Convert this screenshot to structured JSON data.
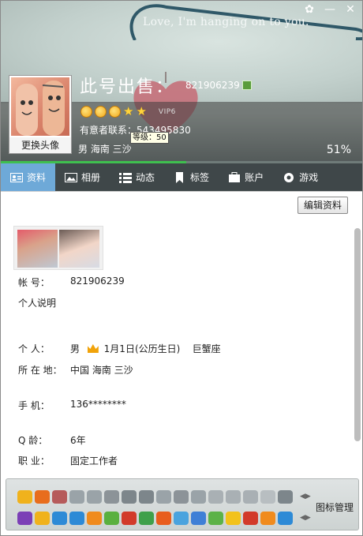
{
  "header": {
    "caption": "Love, I'm hanging on to you.",
    "nickname": "此号出售：",
    "qq_number": "821906239",
    "contact": "有意者联系：543495830",
    "basic": "男   海南 三沙",
    "vip": "VIP6",
    "level_tooltip": "等级：50",
    "profile_completion": "51%",
    "profile_completion_value": 51,
    "avatar_change": "更换头像",
    "window_controls": {
      "skin": "✿",
      "minimize": "—",
      "close": "✕"
    }
  },
  "tabs": [
    {
      "label": "资料",
      "icon": "profile-card-icon",
      "active": true
    },
    {
      "label": "相册",
      "icon": "photo-album-icon",
      "active": false
    },
    {
      "label": "动态",
      "icon": "feed-list-icon",
      "active": false
    },
    {
      "label": "标签",
      "icon": "bookmark-tag-icon",
      "active": false
    },
    {
      "label": "账户",
      "icon": "wallet-account-icon",
      "active": false
    },
    {
      "label": "游戏",
      "icon": "game-icon",
      "active": false
    }
  ],
  "content": {
    "edit_profile": "编辑资料",
    "account_label": "帐    号：",
    "account_value": "821906239",
    "personal_desc": "个人说明",
    "person_label": "个      人：",
    "gender": "男",
    "birthday": "1月1日(公历生日)",
    "zodiac": "巨蟹座",
    "location_label": "所 在 地：",
    "location_value": "中国 海南 三沙",
    "phone_label": "手      机：",
    "phone_value": "136********",
    "age_label": "Q      龄：",
    "age_value": "6年",
    "job_label": "职      业：",
    "job_value": "固定工作者"
  },
  "iconbar": {
    "manage_label": "图标管理"
  },
  "colors": {
    "tab_bar": "#3f4749",
    "tab_active": "#6ea9d8",
    "progress": "#3fbf4f",
    "heart": "#c5707a"
  }
}
